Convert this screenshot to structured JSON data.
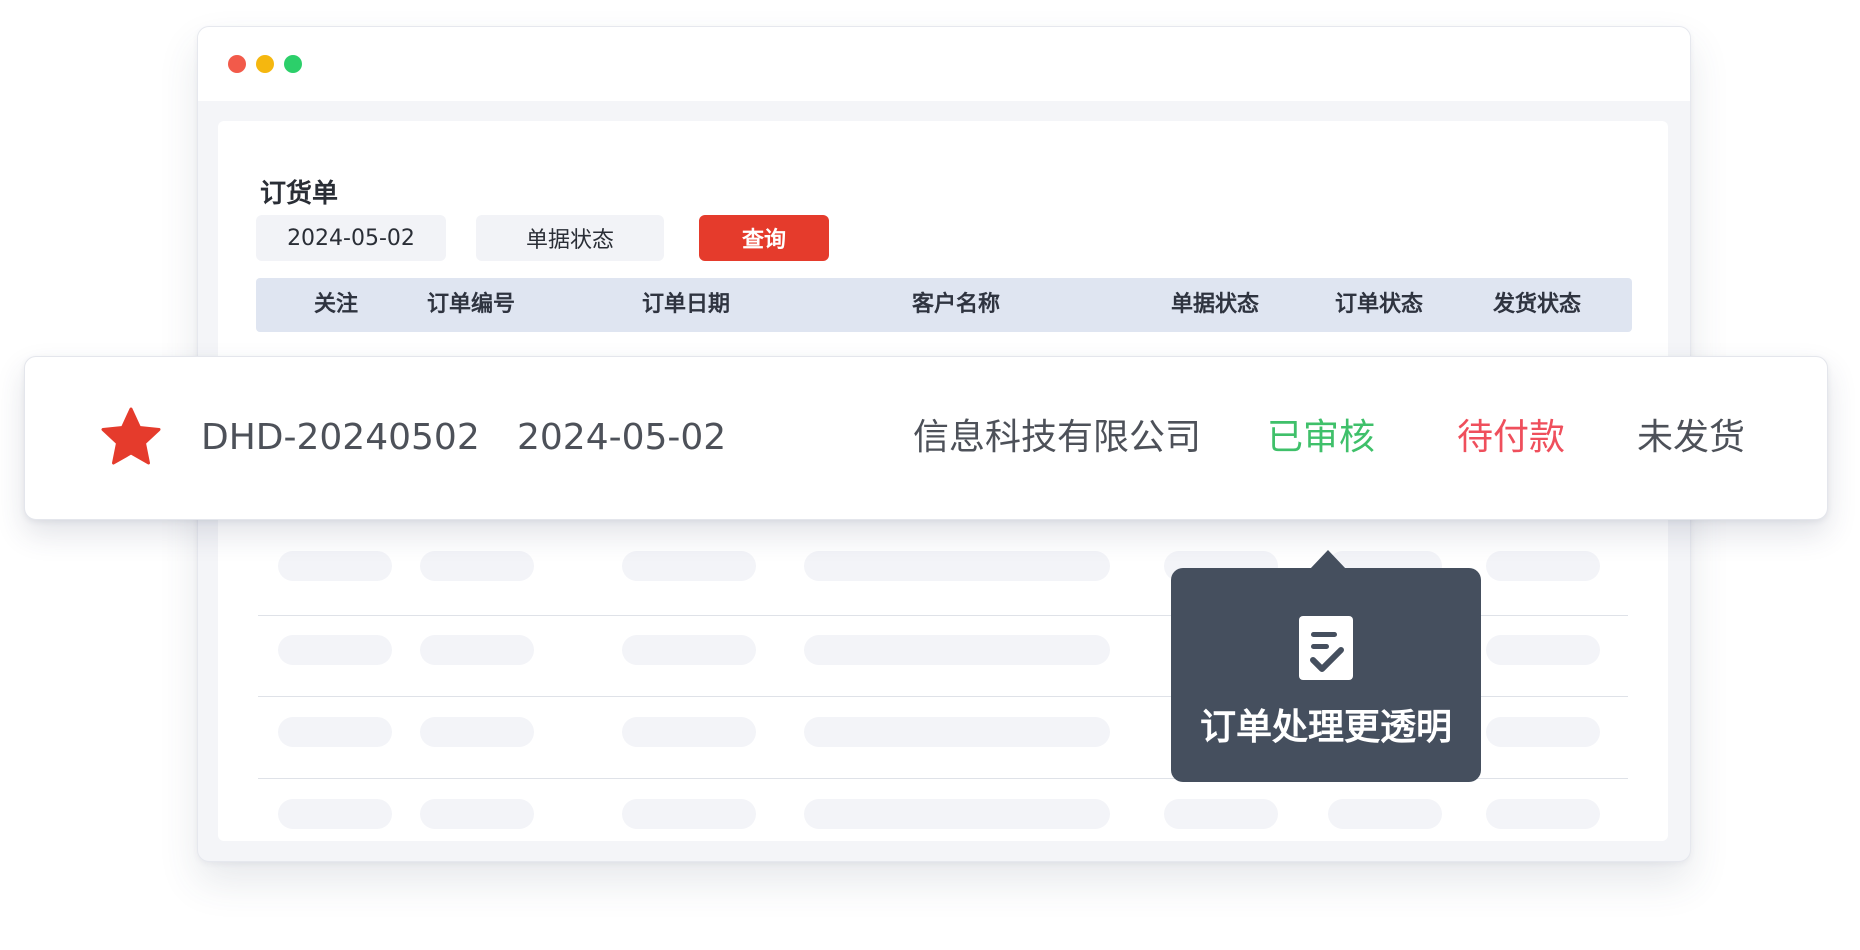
{
  "window": {
    "controls": [
      "close",
      "minimize",
      "maximize"
    ]
  },
  "page": {
    "title": "订货单"
  },
  "filters": {
    "date_value": "2024-05-02",
    "status_placeholder": "单据状态",
    "query_label": "查询"
  },
  "table": {
    "columns": [
      "关注",
      "订单编号",
      "订单日期",
      "客户名称",
      "单据状态",
      "订单状态",
      "发货状态"
    ]
  },
  "highlighted_row": {
    "starred": true,
    "order_no": "DHD-20240502",
    "order_date": "2024-05-02",
    "customer": "信息科技有限公司",
    "document_status": "已审核",
    "order_status": "待付款",
    "shipping_status": "未发货"
  },
  "tooltip": {
    "icon": "document-check-icon",
    "text": "订单处理更透明"
  },
  "colors": {
    "accent_red": "#e53b2c",
    "star": "#e53b2c",
    "status_approved": "#3fc06a",
    "status_pending_payment": "#ef4f5c",
    "tooltip_bg": "#454f5e",
    "header_bg": "#dfe5f1"
  }
}
